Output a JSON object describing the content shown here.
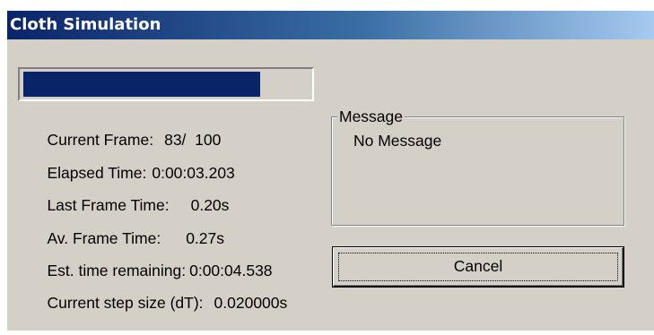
{
  "window": {
    "title": "Cloth Simulation"
  },
  "progress": {
    "value": 0.83
  },
  "stats": {
    "current_frame_label": "Current Frame:",
    "current_frame_value": "83/  100",
    "elapsed_time_label": "Elapsed Time:",
    "elapsed_time_value": "0:00:03.203",
    "last_frame_time_label": "Last Frame Time:",
    "last_frame_time_value": "0.20s",
    "av_frame_time_label": "Av. Frame Time:",
    "av_frame_time_value": "0.27s",
    "est_time_remaining_label": "Est. time remaining:",
    "est_time_remaining_value": "0:00:04.538",
    "step_size_label": "Current step size (dT):",
    "step_size_value": "0.020000s"
  },
  "message_group": {
    "legend": "Message",
    "text": "No Message"
  },
  "buttons": {
    "cancel_label": "Cancel"
  }
}
